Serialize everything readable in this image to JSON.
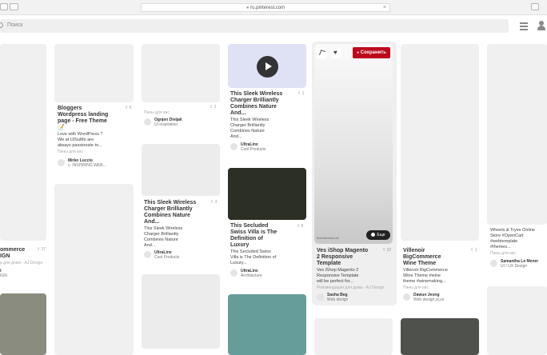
{
  "browser": {
    "url": "ru.pinterest.com"
  },
  "search": {
    "placeholder": "Поиск"
  },
  "pins": {
    "c1a": {
      "title": "ommerce",
      "sub": "IGN",
      "count": "⇧ 17"
    },
    "c1b": {
      "meta": "р для дома - AJ Design",
      "sub2": "t",
      "sub3": "IGN"
    },
    "bloggers": {
      "title1": "Bloggers",
      "title2": "Wordpress landing",
      "title3": "page - Free Theme",
      "emoji": "📝",
      "desc1": "Love with WordPress ?",
      "desc2": "We at UISuMo are",
      "desc3": "always passionate to...",
      "meta": "Пины для вас",
      "count": "⇧ 6",
      "user": "Mirko Luccio",
      "cat": "▷ INSPIRING WEB..."
    },
    "ognjen": {
      "meta": "Пины для вас",
      "count": "⇧ 1",
      "user": "Ognjen Divljak",
      "cat": "UI inspiration"
    },
    "charger2": {
      "title1": "This Sleek Wireless",
      "title2": "Charger Brilliantly",
      "title3": "Combines Nature",
      "title4": "And...",
      "desc1": "This Sleek Wireless",
      "desc2": "Charger Brilliantly",
      "desc3": "Combines Nature",
      "desc4": "And...",
      "count": "⇧ 3",
      "user": "UltraLinx",
      "cat": "Cool Products"
    },
    "charger1": {
      "title1": "This Sleek Wireless",
      "title2": "Charger Brilliantly",
      "title3": "Combines Nature",
      "title4": "And...",
      "desc1": "This Sleek Wireless",
      "desc2": "Charger Brilliantly",
      "desc3": "Combines Nature",
      "desc4": "And...",
      "count": "⇧ 1",
      "user": "UltraLinx",
      "cat": "Cool Products"
    },
    "villa": {
      "title1": "This Secluded",
      "title2": "Swiss Villa is The",
      "title3": "Definition of",
      "title4": "Luxury",
      "desc1": "This Secluded Swiss",
      "desc2": "Villa is The Definition of",
      "desc3": "Luxury...",
      "count": "⇧ 6",
      "user": "UltraLinx",
      "cat": "Architecture"
    },
    "veshop": {
      "save": "Сохранить",
      "visit": "Еще",
      "watermark": "themeforest.net",
      "title1": "Ves iShop Magento",
      "title2": "2 Responsive",
      "title3": "Template",
      "desc1": "Ves iShop Magento 2",
      "desc2": "Responsive Template",
      "desc3": "will be perfect for...",
      "meta": "Рекомендации для дома - AJ Design",
      "count": "⇧ 32",
      "user": "Sasha Beg",
      "cat": "Web design"
    },
    "villenoir": {
      "title1": "Villenoir",
      "title2": "BigCommerce",
      "title3": "Wine Theme",
      "desc1": "Villenoir BigCommerce",
      "desc2": "Wine Theme #wine",
      "desc3": "theme #winemaking...",
      "meta": "Пины для вас",
      "count": "⇧ 1",
      "user": "Dawun Jeong",
      "cat": "Web design,ui,ux"
    },
    "wheels": {
      "desc1": "Wheels & Tryes Online",
      "desc2": "Store #OpenCart",
      "desc3": "#webtemplate",
      "desc4": "#themes...",
      "meta": "Пины для вас",
      "user": "Samantha Le Mener",
      "cat": "UI / UX Design"
    }
  },
  "colors": {
    "save": "#bd081c",
    "dark_green": "#2c3024",
    "teal": "#669d9b",
    "gray_green": "#8a8c80",
    "lavender": "#dfe2f4",
    "slate": "#4f524c"
  }
}
